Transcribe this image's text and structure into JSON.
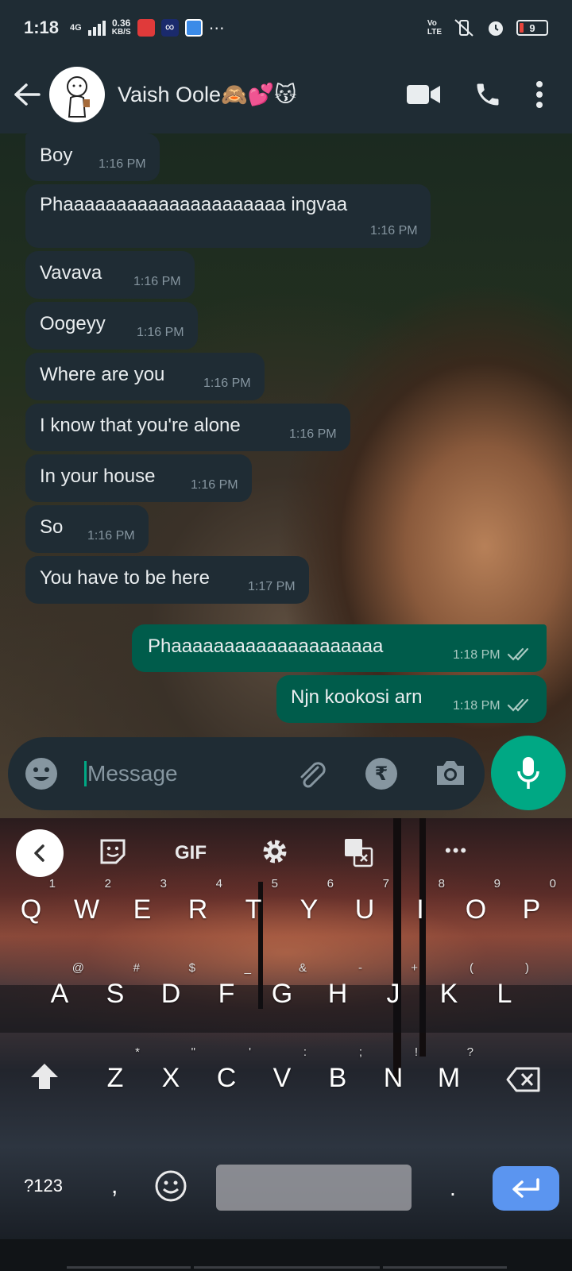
{
  "status_bar": {
    "time": "1:18",
    "network": "4G",
    "speed_value": "0.36",
    "speed_unit": "KB/S",
    "volte": "Vo\nLTE",
    "battery": "9"
  },
  "header": {
    "contact_name": "Vaish Oole🙈💕😽"
  },
  "messages": [
    {
      "dir": "in",
      "text": "Boy",
      "time": "1:16 PM"
    },
    {
      "dir": "in",
      "text": "Phaaaaaaaaaaaaaaaaaaaaa ingvaa",
      "time": "1:16 PM"
    },
    {
      "dir": "in",
      "text": "Vavava",
      "time": "1:16 PM"
    },
    {
      "dir": "in",
      "text": "Oogeyy",
      "time": "1:16 PM"
    },
    {
      "dir": "in",
      "text": "Where are you",
      "time": "1:16 PM"
    },
    {
      "dir": "in",
      "text": "I know that you're alone",
      "time": "1:16 PM"
    },
    {
      "dir": "in",
      "text": "In your house",
      "time": "1:16 PM"
    },
    {
      "dir": "in",
      "text": "So",
      "time": "1:16 PM"
    },
    {
      "dir": "in",
      "text": "You have to be here",
      "time": "1:17 PM"
    },
    {
      "dir": "out",
      "text": "Phaaaaaaaaaaaaaaaaaaaa",
      "time": "1:18 PM",
      "status": "read"
    },
    {
      "dir": "out",
      "text": "Njn kookosi arn",
      "time": "1:18 PM",
      "status": "read"
    }
  ],
  "composer": {
    "placeholder": "Message",
    "currency_symbol": "₹"
  },
  "keyboard": {
    "toolbar": {
      "gif_label": "GIF",
      "more_label": "•••"
    },
    "row1": [
      {
        "k": "Q",
        "h": "1"
      },
      {
        "k": "W",
        "h": "2"
      },
      {
        "k": "E",
        "h": "3"
      },
      {
        "k": "R",
        "h": "4"
      },
      {
        "k": "T",
        "h": "5"
      },
      {
        "k": "Y",
        "h": "6"
      },
      {
        "k": "U",
        "h": "7"
      },
      {
        "k": "I",
        "h": "8"
      },
      {
        "k": "O",
        "h": "9"
      },
      {
        "k": "P",
        "h": "0"
      }
    ],
    "row2": [
      {
        "k": "A",
        "h": "@"
      },
      {
        "k": "S",
        "h": "#"
      },
      {
        "k": "D",
        "h": "$"
      },
      {
        "k": "F",
        "h": "_"
      },
      {
        "k": "G",
        "h": "&"
      },
      {
        "k": "H",
        "h": "-"
      },
      {
        "k": "J",
        "h": "+"
      },
      {
        "k": "K",
        "h": "("
      },
      {
        "k": "L",
        "h": ")"
      }
    ],
    "row3": [
      {
        "k": "Z",
        "h": "*"
      },
      {
        "k": "X",
        "h": "\""
      },
      {
        "k": "C",
        "h": "'"
      },
      {
        "k": "V",
        "h": ":"
      },
      {
        "k": "B",
        "h": ";"
      },
      {
        "k": "N",
        "h": "!"
      },
      {
        "k": "M",
        "h": "?"
      }
    ],
    "symbols_label": "?123",
    "comma": ",",
    "period": "."
  },
  "colors": {
    "header_bg": "#1f2c34",
    "incoming_bubble": "#1f2c34",
    "outgoing_bubble": "#005c4b",
    "accent": "#00a884",
    "enter_key": "#5b95f0"
  }
}
